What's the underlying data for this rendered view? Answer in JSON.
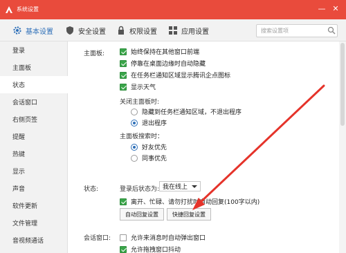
{
  "window": {
    "title": "系统设置",
    "minimize_glyph": "—",
    "close_glyph": "✕"
  },
  "tabs": [
    {
      "label": "基本设置",
      "icon": "gear-icon",
      "active": true
    },
    {
      "label": "安全设置",
      "icon": "shield-icon",
      "active": false
    },
    {
      "label": "权限设置",
      "icon": "lock-icon",
      "active": false
    },
    {
      "label": "应用设置",
      "icon": "apps-grid-icon",
      "active": false
    }
  ],
  "search": {
    "placeholder": "搜索设置项"
  },
  "sidebar": {
    "items": [
      "登录",
      "主面板",
      "状态",
      "会话窗口",
      "右侧页签",
      "提醒",
      "热键",
      "显示",
      "声音",
      "软件更新",
      "文件管理",
      "音视频通话"
    ],
    "active_index": 2
  },
  "main_panel": {
    "label": "主面板:",
    "options": [
      {
        "label": "始终保持在其他窗口前端",
        "checked": true
      },
      {
        "label": "停靠在桌面边缘时自动隐藏",
        "checked": true
      },
      {
        "label": "在任务栏通知区域显示腾讯企点图标",
        "checked": true
      },
      {
        "label": "显示天气",
        "checked": true
      }
    ],
    "close_label": "关闭主面板时:",
    "close_options": [
      {
        "label": "隐藏到任务栏通知区域，不退出程序",
        "selected": false
      },
      {
        "label": "退出程序",
        "selected": true
      }
    ],
    "search_label": "主面板搜索时：",
    "search_options": [
      {
        "label": "好友优先",
        "selected": true
      },
      {
        "label": "同事优先",
        "selected": false
      }
    ]
  },
  "status": {
    "label": "状态:",
    "after_login_label": "登录后状态为:",
    "after_login_value": "我在线上",
    "auto_reply_label": "离开、忙碌、请勿打扰时自动回复(100字以内)",
    "auto_reply_checked": true,
    "auto_reply_button": "自动回复设置",
    "quick_reply_button": "快捷回复设置"
  },
  "session": {
    "label": "会话窗口:",
    "popup_label": "允许来消息时自动弹出窗口",
    "popup_checked": false,
    "drag_label": "允许拖拽窗口抖动",
    "drag_checked": true
  },
  "colors": {
    "titlebar": "#e94b3c",
    "accent": "#2d6fb8",
    "check": "#3aa54a",
    "arrow": "#e5332a"
  }
}
